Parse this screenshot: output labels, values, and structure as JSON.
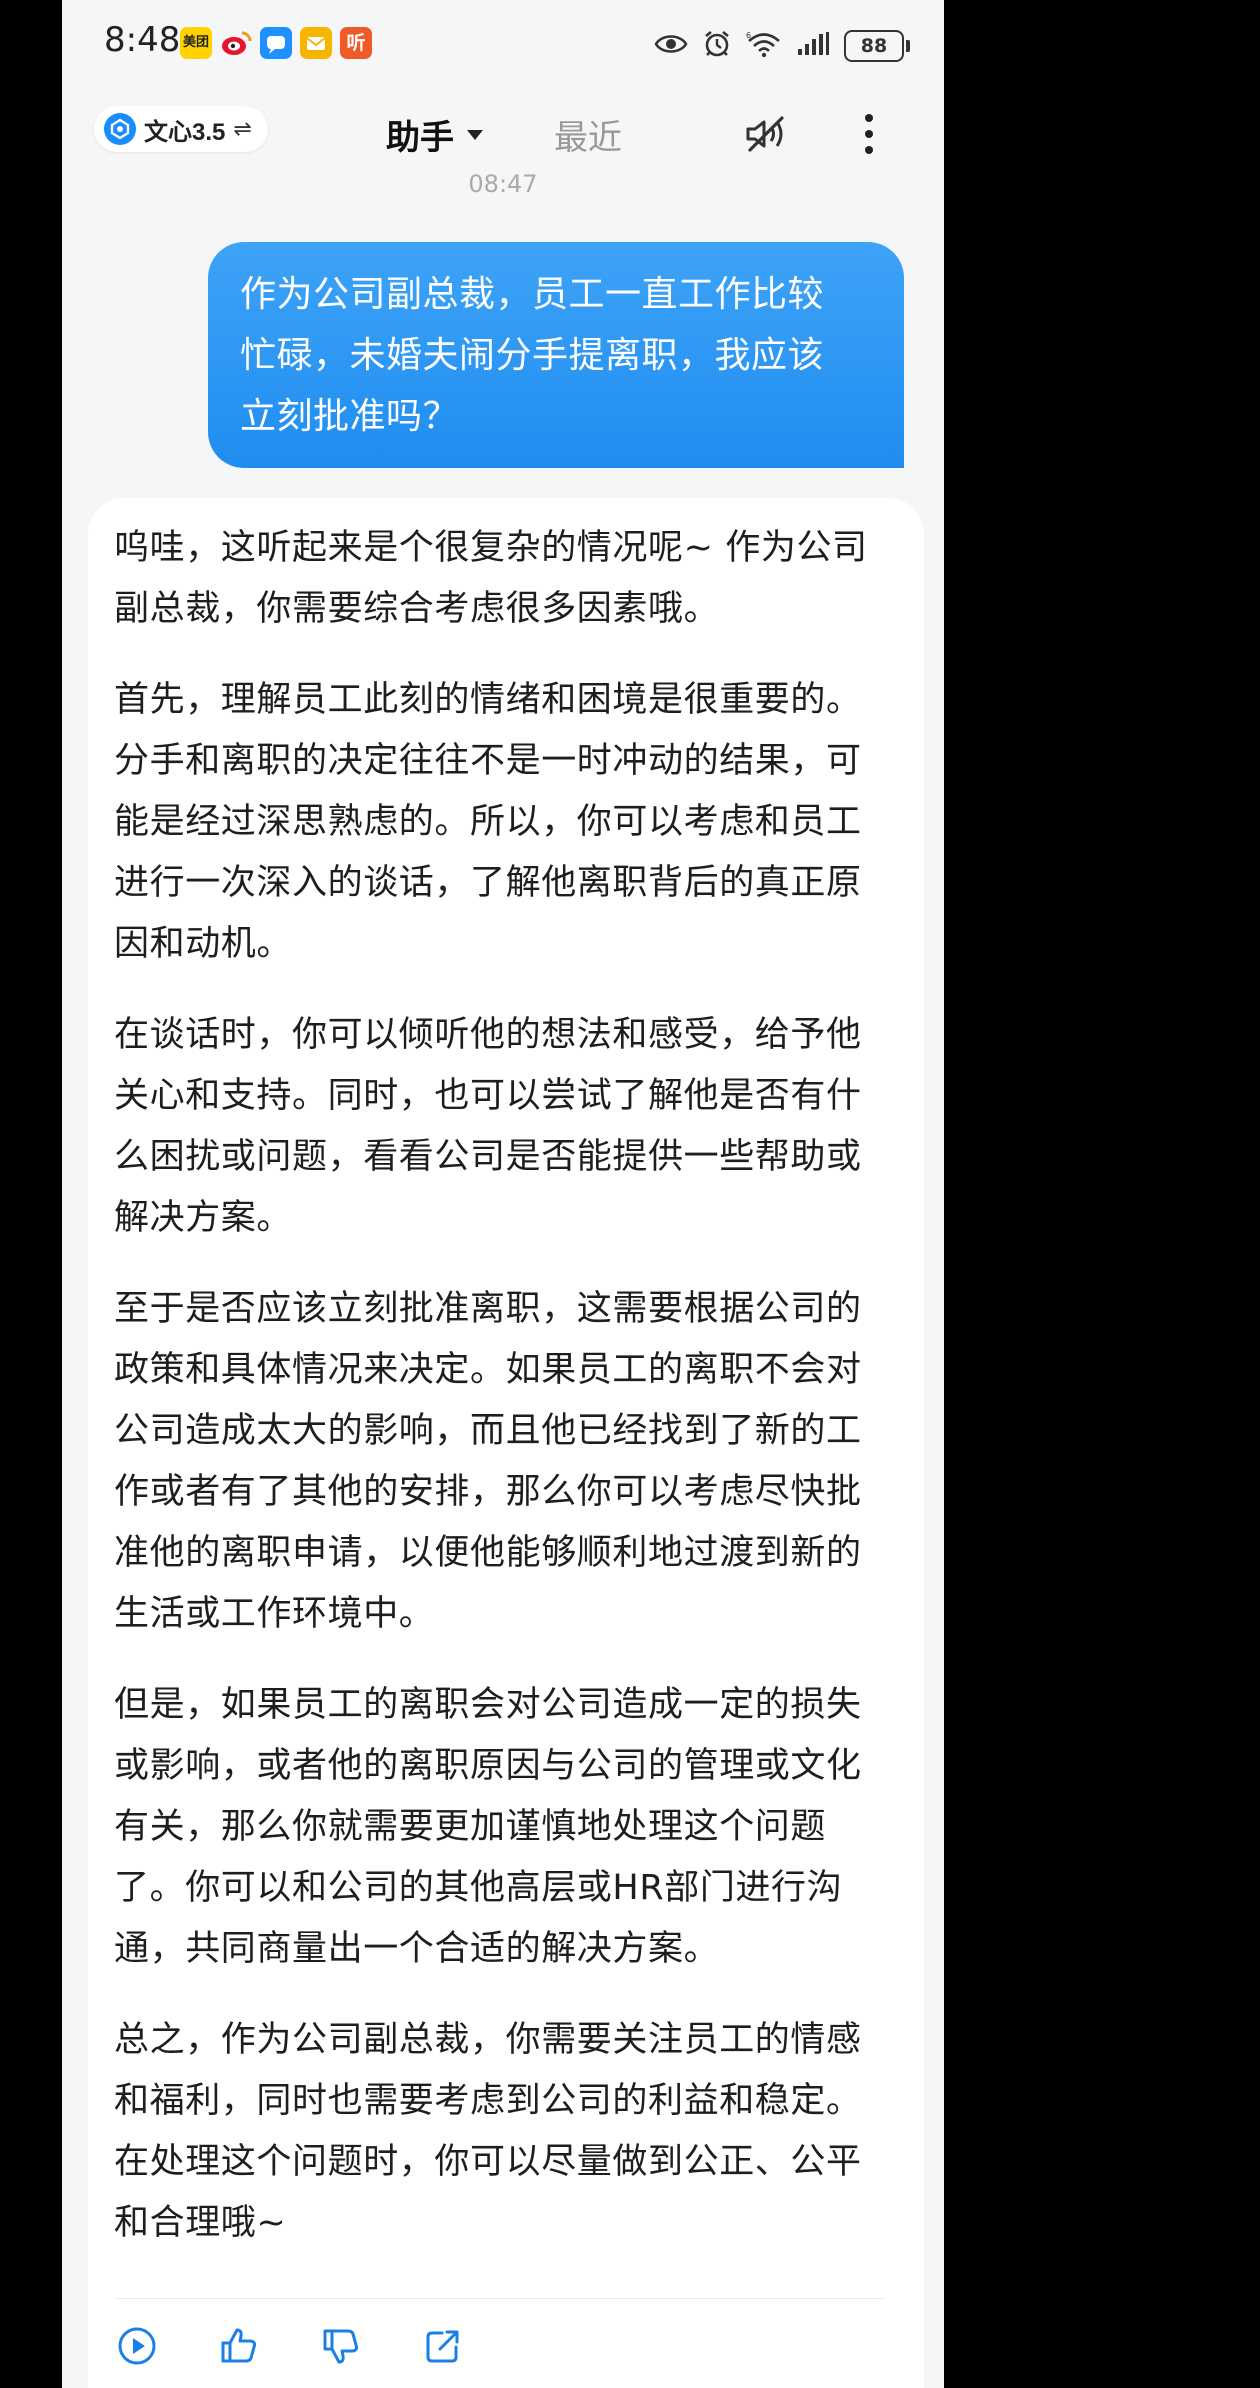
{
  "status_bar": {
    "time": "8:48",
    "battery": "88",
    "notification_icons": [
      "meituan-icon",
      "weibo-icon",
      "chat-icon",
      "mail-icon",
      "listen-icon"
    ],
    "system_icons": [
      "eye-icon",
      "alarm-icon",
      "wifi-icon",
      "signal-icon",
      "battery-icon"
    ],
    "meituan_label": "美团",
    "listen_label": "听"
  },
  "header": {
    "model_label": "文心3.5",
    "swap_symbol": "⇌",
    "tab_assistant": "助手",
    "tab_recent": "最近"
  },
  "timestamp": "08:47",
  "user_message": "作为公司副总裁，员工一直工作比较\n忙碌，未婚夫闹分手提离职，我应该\n立刻批准吗？",
  "assistant_message": {
    "paragraphs": [
      "呜哇，这听起来是个很复杂的情况呢~ 作为公司副总裁，你需要综合考虑很多因素哦。",
      "首先，理解员工此刻的情绪和困境是很重要的。分手和离职的决定往往不是一时冲动的结果，可能是经过深思熟虑的。所以，你可以考虑和员工进行一次深入的谈话，了解他离职背后的真正原因和动机。",
      "在谈话时，你可以倾听他的想法和感受，给予他关心和支持。同时，也可以尝试了解他是否有什么困扰或问题，看看公司是否能提供一些帮助或解决方案。",
      "至于是否应该立刻批准离职，这需要根据公司的政策和具体情况来决定。如果员工的离职不会对公司造成太大的影响，而且他已经找到了新的工作或者有了其他的安排，那么你可以考虑尽快批准他的离职申请，以便他能够顺利地过渡到新的生活或工作环境中。",
      "但是，如果员工的离职会对公司造成一定的损失或影响，或者他的离职原因与公司的管理或文化有关，那么你就需要更加谨慎地处理这个问题了。你可以和公司的其他高层或HR部门进行沟通，共同商量出一个合适的解决方案。",
      "总之，作为公司副总裁，你需要关注员工的情感和福利，同时也需要考虑到公司的利益和稳定。在处理这个问题时，你可以尽量做到公正、公平和合理哦~"
    ],
    "actions": [
      "play-icon",
      "thumbs-up-icon",
      "thumbs-down-icon",
      "share-icon"
    ]
  },
  "colors": {
    "user_bubble": "#2196f3",
    "page_background": "#f5f6f8",
    "outer_background": "#000000"
  }
}
